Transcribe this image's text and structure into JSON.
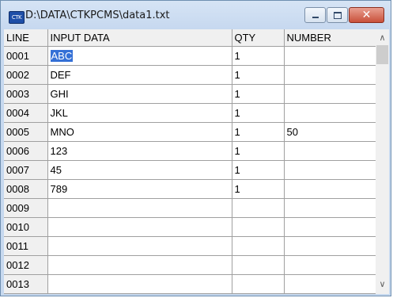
{
  "window": {
    "icon_label": "CTK",
    "title": "D:\\DATA\\CTKPCMS\\data1.txt",
    "close_glyph": "✕",
    "accent_close": "#c9503a",
    "selection_color": "#3470d6"
  },
  "grid": {
    "headers": {
      "line": "LINE",
      "input": "INPUT DATA",
      "qty": "QTY",
      "number": "NUMBER"
    },
    "rows": [
      {
        "line": "0001",
        "input": "ABC",
        "qty": "1",
        "number": ""
      },
      {
        "line": "0002",
        "input": "DEF",
        "qty": "1",
        "number": ""
      },
      {
        "line": "0003",
        "input": "GHI",
        "qty": "1",
        "number": ""
      },
      {
        "line": "0004",
        "input": "JKL",
        "qty": "1",
        "number": ""
      },
      {
        "line": "0005",
        "input": "MNO",
        "qty": "1",
        "number": "50"
      },
      {
        "line": "0006",
        "input": "123",
        "qty": "1",
        "number": ""
      },
      {
        "line": "0007",
        "input": "45",
        "qty": "1",
        "number": ""
      },
      {
        "line": "0008",
        "input": "789",
        "qty": "1",
        "number": ""
      },
      {
        "line": "0009",
        "input": "",
        "qty": "",
        "number": ""
      },
      {
        "line": "0010",
        "input": "",
        "qty": "",
        "number": ""
      },
      {
        "line": "0011",
        "input": "",
        "qty": "",
        "number": ""
      },
      {
        "line": "0012",
        "input": "",
        "qty": "",
        "number": ""
      },
      {
        "line": "0013",
        "input": "",
        "qty": "",
        "number": ""
      }
    ]
  },
  "scrollbar": {
    "up_glyph": "∧",
    "down_glyph": "∨"
  }
}
